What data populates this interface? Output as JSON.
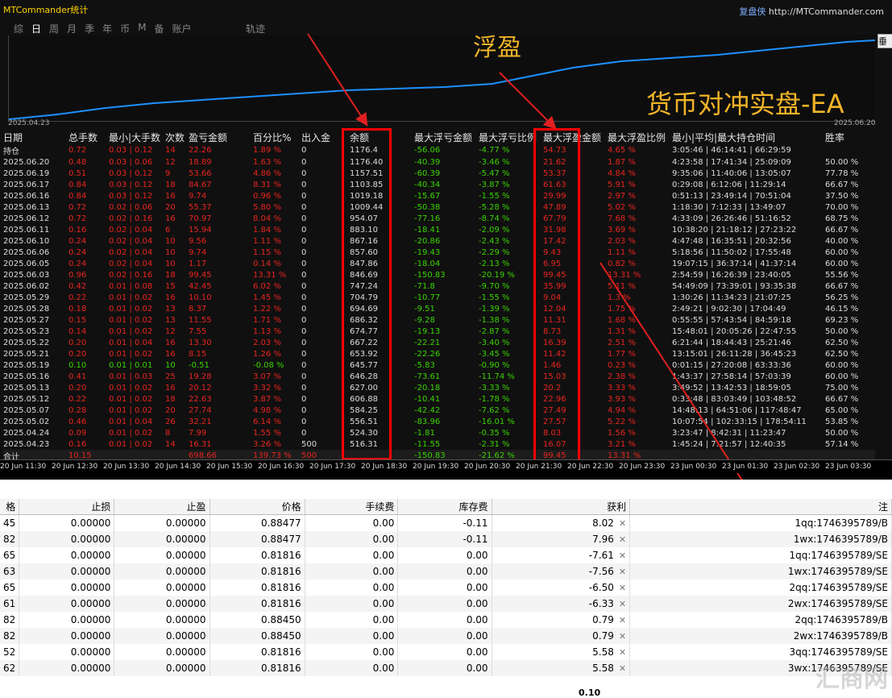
{
  "header": {
    "title": "MTCommander统计",
    "site_name": "复盘侠",
    "site_url": "http://MTCommander.com",
    "tabs": [
      "综",
      "日",
      "周",
      "月",
      "季",
      "年",
      "币",
      "M",
      "备",
      "账户"
    ],
    "active_tab": "日",
    "track_label": "轨迹",
    "side_button": "垂"
  },
  "chart": {
    "start_date": "2025.04.23",
    "end_date": "2025.06.20",
    "line_color": "#1e90ff"
  },
  "annotations": {
    "floating": "浮盈",
    "strategy": "货币对冲实盘-EA"
  },
  "stats": {
    "headers": [
      "日期",
      "总手数",
      "最小|大手数",
      "次数",
      "盈亏金额",
      "百分比%",
      "出入金",
      "余额",
      "最大浮亏金额",
      "最大浮亏比例",
      "最大浮盈金额",
      "最大浮盈比例",
      "最小|平均|最大持仓时间",
      "胜率"
    ],
    "rows": [
      [
        "持仓",
        "0.72",
        "0.03 | 0.12",
        "14",
        "22.26",
        "1.89 %",
        "0",
        "1176.4",
        "-56.06",
        "-4.77 %",
        "54.73",
        "4.65 %",
        "3:05:46 | 46:14:41 | 66:29:59",
        ""
      ],
      [
        "2025.06.20",
        "0.48",
        "0.03 | 0.06",
        "12",
        "18.89",
        "1.63 %",
        "0",
        "1176.40",
        "-40.39",
        "-3.46 %",
        "21.62",
        "1.87 %",
        "4:23:58 | 17:41:34 | 25:09:09",
        "50.00 %"
      ],
      [
        "2025.06.19",
        "0.51",
        "0.03 | 0.12",
        "9",
        "53.66",
        "4.86 %",
        "0",
        "1157.51",
        "-60.39",
        "-5.47 %",
        "53.37",
        "4.84 %",
        "9:35:06 | 11:40:06 | 13:05:07",
        "77.78 %"
      ],
      [
        "2025.06.17",
        "0.84",
        "0.03 | 0.12",
        "18",
        "84.67",
        "8.31 %",
        "0",
        "1103.85",
        "-40.34",
        "-3.87 %",
        "61.63",
        "5.91 %",
        "0:29:08 | 6:12:06 | 11:29:14",
        "66.67 %"
      ],
      [
        "2025.06.16",
        "0.84",
        "0.03 | 0.12",
        "16",
        "9.74",
        "0.96 %",
        "0",
        "1019.18",
        "-15.67",
        "-1.55 %",
        "29.99",
        "2.97 %",
        "0:51:13 | 23:49:14 | 70:51:04",
        "37.50 %"
      ],
      [
        "2025.06.13",
        "0.72",
        "0.02 | 0.06",
        "20",
        "55.37",
        "5.80 %",
        "0",
        "1009.44",
        "-50.38",
        "-5.28 %",
        "47.89",
        "5.02 %",
        "1:18:30 | 7:12:33 | 13:49:07",
        "70.00 %"
      ],
      [
        "2025.06.12",
        "0.72",
        "0.02 | 0.16",
        "16",
        "70.97",
        "8.04 %",
        "0",
        "954.07",
        "-77.16",
        "-8.74 %",
        "67.79",
        "7.68 %",
        "4:33:09 | 26:26:46 | 51:16:52",
        "68.75 %"
      ],
      [
        "2025.06.11",
        "0.16",
        "0.02 | 0.04",
        "6",
        "15.94",
        "1.84 %",
        "0",
        "883.10",
        "-18.41",
        "-2.09 %",
        "31.98",
        "3.69 %",
        "10:38:20 | 21:18:12 | 27:23:22",
        "66.67 %"
      ],
      [
        "2025.06.10",
        "0.24",
        "0.02 | 0.04",
        "10",
        "9.56",
        "1.11 %",
        "0",
        "867.16",
        "-20.86",
        "-2.43 %",
        "17.42",
        "2.03 %",
        "4:47:48 | 16:35:51 | 20:32:56",
        "40.00 %"
      ],
      [
        "2025.06.06",
        "0.24",
        "0.02 | 0.04",
        "10",
        "9.74",
        "1.15 %",
        "0",
        "857.60",
        "-19.43",
        "-2.29 %",
        "9.43",
        "1.11 %",
        "5:18:56 | 11:50:02 | 17:55:48",
        "60.00 %"
      ],
      [
        "2025.06.05",
        "0.24",
        "0.02 | 0.04",
        "10",
        "1.17",
        "0.14 %",
        "0",
        "847.86",
        "-18.04",
        "-2.13 %",
        "6.95",
        "0.82 %",
        "19:07:15 | 36:37:14 | 41:37:14",
        "60.00 %"
      ],
      [
        "2025.06.03",
        "0.96",
        "0.02 | 0.16",
        "18",
        "99.45",
        "13.31 %",
        "0",
        "846.69",
        "-150.83",
        "-20.19 %",
        "99.45",
        "13.31 %",
        "2:54:59 | 16:26:39 | 23:40:05",
        "55.56 %"
      ],
      [
        "2025.06.02",
        "0.42",
        "0.01 | 0.08",
        "15",
        "42.45",
        "6.02 %",
        "0",
        "747.24",
        "-71.8",
        "-9.70 %",
        "35.99",
        "5.11 %",
        "54:49:09 | 73:39:01 | 93:35:38",
        "66.67 %"
      ],
      [
        "2025.05.29",
        "0.22",
        "0.01 | 0.02",
        "16",
        "10.10",
        "1.45 %",
        "0",
        "704.79",
        "-10.77",
        "-1.55 %",
        "9.04",
        "1.3 %",
        "1:30:26 | 11:34:23 | 21:07:25",
        "56.25 %"
      ],
      [
        "2025.05.28",
        "0.18",
        "0.01 | 0.02",
        "13",
        "8.37",
        "1.22 %",
        "0",
        "694.69",
        "-9.51",
        "-1.39 %",
        "12.04",
        "1.75 %",
        "2:49:21 | 9:02:30 | 17:04:49",
        "46.15 %"
      ],
      [
        "2025.05.27",
        "0.15",
        "0.01 | 0.02",
        "13",
        "11.55",
        "1.71 %",
        "0",
        "686.32",
        "-9.28",
        "-1.38 %",
        "11.31",
        "1.68 %",
        "0:55:55 | 57:43:54 | 84:59:18",
        "69.23 %"
      ],
      [
        "2025.05.23",
        "0.14",
        "0.01 | 0.02",
        "12",
        "7.55",
        "1.13 %",
        "0",
        "674.77",
        "-19.13",
        "-2.87 %",
        "8.73",
        "1.31 %",
        "15:48:01 | 20:05:26 | 22:47:55",
        "50.00 %"
      ],
      [
        "2025.05.22",
        "0.20",
        "0.01 | 0.04",
        "16",
        "13.30",
        "2.03 %",
        "0",
        "667.22",
        "-22.21",
        "-3.40 %",
        "16.39",
        "2.51 %",
        "6:21:44 | 18:44:43 | 25:21:46",
        "62.50 %"
      ],
      [
        "2025.05.21",
        "0.20",
        "0.01 | 0.02",
        "16",
        "8.15",
        "1.26 %",
        "0",
        "653.92",
        "-22.26",
        "-3.45 %",
        "11.42",
        "1.77 %",
        "13:15:01 | 26:11:28 | 36:45:23",
        "62.50 %"
      ],
      [
        "2025.05.19",
        "0.10",
        "0.01 | 0.01",
        "10",
        "-0.51",
        "-0.08 %",
        "0",
        "645.77",
        "-5.83",
        "-0.90 %",
        "1.46",
        "0.23 %",
        "0:01:15 | 27:20:08 | 63:33:36",
        "60.00 %"
      ],
      [
        "2025.05.16",
        "0.41",
        "0.01 | 0.03",
        "25",
        "19.28",
        "3.07 %",
        "0",
        "646.28",
        "-73.61",
        "-11.74 %",
        "15.03",
        "2.38 %",
        "1:43:37 | 27:58:14 | 57:03:39",
        "60.00 %"
      ],
      [
        "2025.05.13",
        "0.20",
        "0.01 | 0.02",
        "16",
        "20.12",
        "3.32 %",
        "0",
        "627.00",
        "-20.18",
        "-3.33 %",
        "20.2",
        "3.33 %",
        "3:49:52 | 13:42:53 | 18:59:05",
        "75.00 %"
      ],
      [
        "2025.05.12",
        "0.22",
        "0.01 | 0.02",
        "18",
        "22.63",
        "3.87 %",
        "0",
        "606.88",
        "-10.41",
        "-1.78 %",
        "22.96",
        "3.93 %",
        "0:33:48 | 83:03:49 | 103:48:52",
        "66.67 %"
      ],
      [
        "2025.05.07",
        "0.28",
        "0.01 | 0.02",
        "20",
        "27.74",
        "4.98 %",
        "0",
        "584.25",
        "-42.42",
        "-7.62 %",
        "27.49",
        "4.94 %",
        "14:48:13 | 64:51:06 | 117:48:47",
        "65.00 %"
      ],
      [
        "2025.05.02",
        "0.46",
        "0.01 | 0.04",
        "26",
        "32.21",
        "6.14 %",
        "0",
        "556.51",
        "-83.96",
        "-16.01 %",
        "27.57",
        "5.22 %",
        "10:07:54 | 102:33:15 | 178:54:11",
        "53.85 %"
      ],
      [
        "2025.04.24",
        "0.09",
        "0.01 | 0.02",
        "8",
        "7.99",
        "1.55 %",
        "0",
        "524.30",
        "-1.81",
        "-0.35 %",
        "8.03",
        "1.56 %",
        "3:23:47 | 8:42:31 | 11:23:47",
        "50.00 %"
      ],
      [
        "2025.04.23",
        "0.16",
        "0.01 | 0.02",
        "14",
        "16.31",
        "3.26 %",
        "500",
        "516.31",
        "-11.55",
        "-2.31 %",
        "16.07",
        "3.21 %",
        "1:45:24 | 7:21:57 | 12:40:35",
        "57.14 %"
      ]
    ],
    "total": [
      "合计",
      "10.15",
      "",
      "",
      "698.66",
      "139.73 %",
      "500",
      "",
      "-150.83",
      "-21.62 %",
      "99.45",
      "13.31 %",
      "",
      ""
    ]
  },
  "time_axis": [
    "20 Jun 11:30",
    "20 Jun 12:30",
    "20 Jun 13:30",
    "20 Jun 14:30",
    "20 Jun 15:30",
    "20 Jun 16:30",
    "20 Jun 17:30",
    "20 Jun 18:30",
    "20 Jun 19:30",
    "20 Jun 20:30",
    "20 Jun 21:30",
    "20 Jun 22:30",
    "20 Jun 23:30",
    "23 Jun 00:30",
    "23 Jun 01:30",
    "23 Jun 02:30",
    "23 Jun 03:30"
  ],
  "orders": {
    "headers": [
      "格",
      "止损",
      "止盈",
      "价格",
      "手续费",
      "库存费",
      "获利",
      "注"
    ],
    "rows": [
      [
        "45",
        "0.00000",
        "0.00000",
        "0.88477",
        "0.00",
        "-0.11",
        "8.02",
        "1qq:1746395789/B"
      ],
      [
        "82",
        "0.00000",
        "0.00000",
        "0.88477",
        "0.00",
        "-0.11",
        "7.96",
        "1wx:1746395789/B"
      ],
      [
        "65",
        "0.00000",
        "0.00000",
        "0.81816",
        "0.00",
        "0.00",
        "-7.61",
        "1qq:1746395789/SE"
      ],
      [
        "63",
        "0.00000",
        "0.00000",
        "0.81816",
        "0.00",
        "0.00",
        "-7.56",
        "1wx:1746395789/SE"
      ],
      [
        "65",
        "0.00000",
        "0.00000",
        "0.81816",
        "0.00",
        "0.00",
        "-6.50",
        "2qq:1746395789/SE"
      ],
      [
        "61",
        "0.00000",
        "0.00000",
        "0.81816",
        "0.00",
        "0.00",
        "-6.33",
        "2wx:1746395789/SE"
      ],
      [
        "82",
        "0.00000",
        "0.00000",
        "0.88450",
        "0.00",
        "0.00",
        "0.79",
        "2qq:1746395789/B"
      ],
      [
        "82",
        "0.00000",
        "0.00000",
        "0.88450",
        "0.00",
        "0.00",
        "0.79",
        "2wx:1746395789/B"
      ],
      [
        "52",
        "0.00000",
        "0.00000",
        "0.81816",
        "0.00",
        "0.00",
        "5.58",
        "3qq:1746395789/SE"
      ],
      [
        "62",
        "0.00000",
        "0.00000",
        "0.81816",
        "0.00",
        "0.00",
        "5.58",
        "3wx:1746395789/SE"
      ]
    ],
    "footer_total": "0.10"
  },
  "watermark": "汇商网"
}
